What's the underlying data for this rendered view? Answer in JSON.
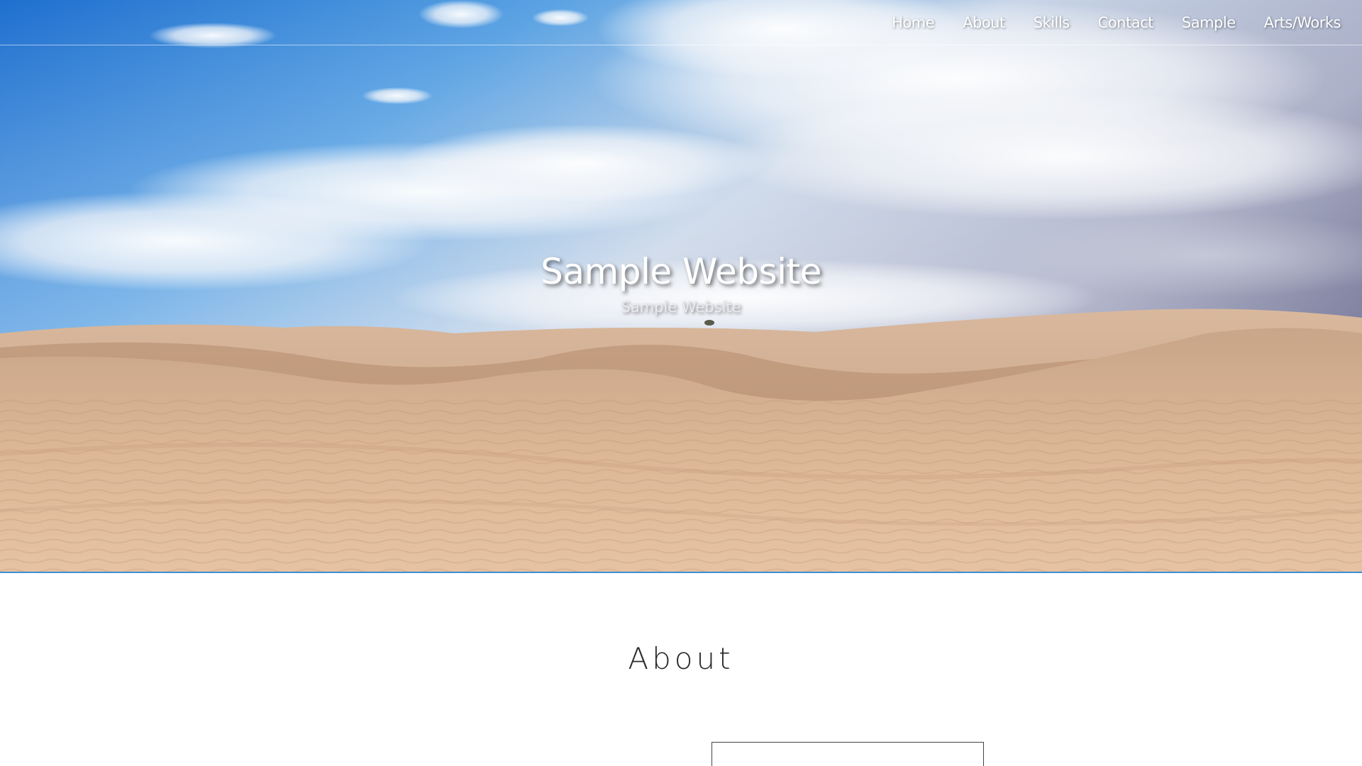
{
  "nav": {
    "items": [
      {
        "label": "Home"
      },
      {
        "label": "About"
      },
      {
        "label": "Skills"
      },
      {
        "label": "Contact"
      },
      {
        "label": "Sample"
      },
      {
        "label": "Arts/Works"
      }
    ]
  },
  "hero": {
    "title": "Sample Website",
    "subtitle": "Sample Website",
    "accent_color": "#3d8fd8"
  },
  "about": {
    "heading": "About"
  }
}
